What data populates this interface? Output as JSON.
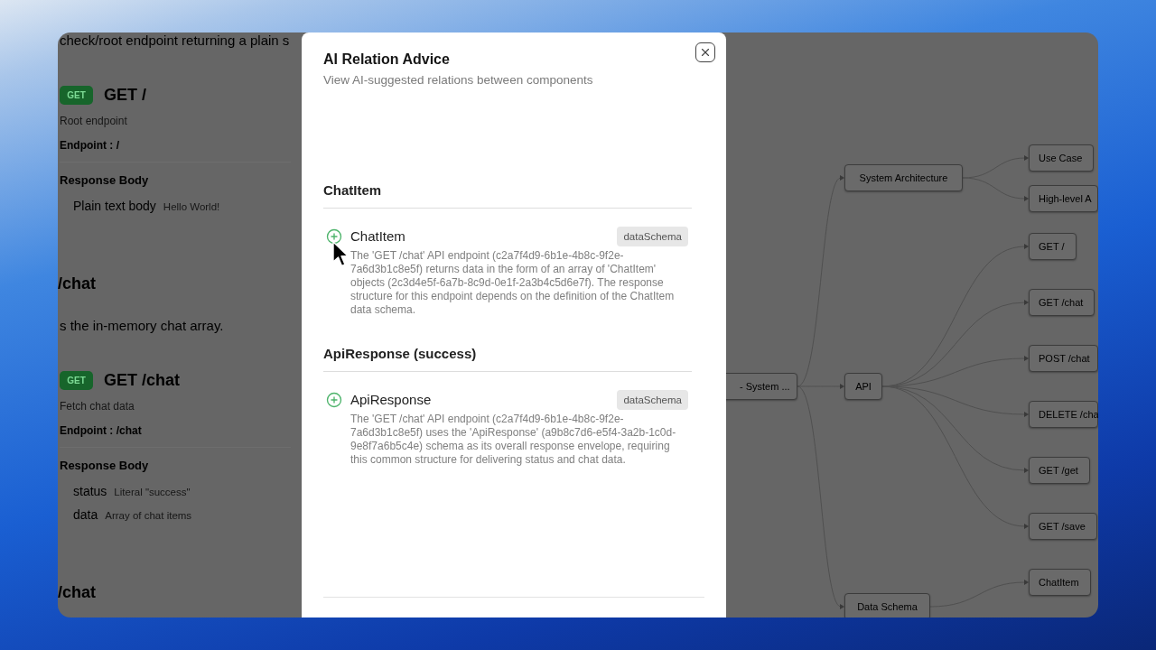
{
  "left_panel": {
    "items": [
      {
        "kind": "text",
        "text": "check/root endpoint returning a plain s"
      },
      {
        "kind": "endpoint",
        "method": "GET",
        "title": "GET /",
        "description": "Root endpoint",
        "endpoint": "Endpoint : /",
        "response_heading": "Response Body",
        "fields": [
          {
            "name": "Plain text body",
            "detail": "Hello World!"
          }
        ]
      },
      {
        "kind": "heading",
        "text": "/chat"
      },
      {
        "kind": "text",
        "text": "s the in-memory chat array."
      },
      {
        "kind": "endpoint",
        "method": "GET",
        "title": "GET /chat",
        "description": "Fetch chat data",
        "endpoint": "Endpoint : /chat",
        "response_heading": "Response Body",
        "fields": [
          {
            "name": "status",
            "detail": "Literal \"success\""
          },
          {
            "name": "data",
            "detail": "Array of chat items"
          }
        ]
      },
      {
        "kind": "heading",
        "text": "/chat"
      }
    ]
  },
  "dialog": {
    "title": "AI Relation Advice",
    "subtitle": "View AI-suggested relations between components",
    "sections": [
      {
        "heading": "ChatItem",
        "items": [
          {
            "name": "ChatItem",
            "tag": "dataSchema",
            "description": "The 'GET /chat' API endpoint (c2a7f4d9-6b1e-4b8c-9f2e-7a6d3b1c8e5f) returns data in the form of an array of 'ChatItem' objects (2c3d4e5f-6a7b-8c9d-0e1f-2a3b4c5d6e7f). The response structure for this endpoint depends on the definition of the ChatItem data schema."
          }
        ]
      },
      {
        "heading": "ApiResponse (success)",
        "items": [
          {
            "name": "ApiResponse",
            "tag": "dataSchema",
            "description": "The 'GET /chat' API endpoint (c2a7f4d9-6b1e-4b8c-9f2e-7a6d3b1c8e5f) uses the 'ApiResponse' (a9b8c7d6-e5f4-3a2b-1c0d-9e8f7a6b5c4e) schema as its overall response envelope, requiring this common structure for delivering status and chat data."
          }
        ]
      }
    ]
  },
  "diagram": {
    "root": {
      "label": "- System ...",
      "children": [
        {
          "label": "System Architecture",
          "children": [
            {
              "label": "Use Case"
            },
            {
              "label": "High-level A"
            }
          ]
        },
        {
          "label": "API",
          "children": [
            {
              "label": "GET /"
            },
            {
              "label": "GET /chat"
            },
            {
              "label": "POST /chat"
            },
            {
              "label": "DELETE /cha"
            },
            {
              "label": "GET /get"
            },
            {
              "label": "GET /save"
            }
          ]
        },
        {
          "label": "Data Schema",
          "children": [
            {
              "label": "ChatItem"
            }
          ]
        }
      ]
    }
  }
}
